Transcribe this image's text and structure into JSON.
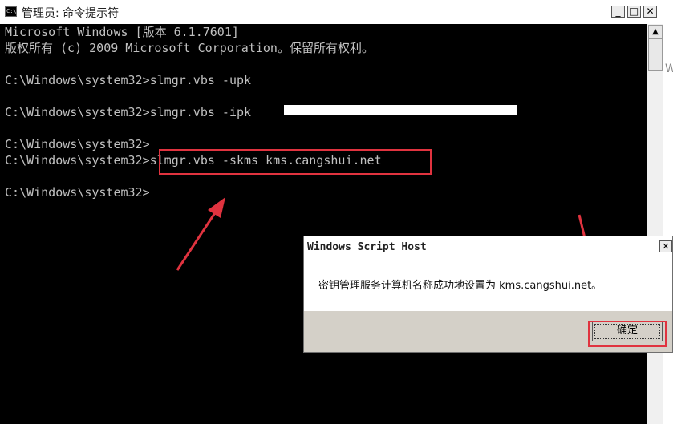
{
  "window": {
    "title": "管理员: 命令提示符",
    "icon_label": "C:\\",
    "minimize_glyph": "_",
    "maximize_glyph": "□",
    "close_glyph": "✕"
  },
  "console": {
    "lines": [
      "Microsoft Windows [版本 6.1.7601]",
      "版权所有 (c) 2009 Microsoft Corporation。保留所有权利。",
      "",
      "C:\\Windows\\system32>slmgr.vbs -upk",
      "",
      "C:\\Windows\\system32>slmgr.vbs -ipk",
      "",
      "C:\\Windows\\system32>",
      "C:\\Windows\\system32>slmgr.vbs -skms kms.cangshui.net",
      "",
      "C:\\Windows\\system32>"
    ]
  },
  "scrollbar": {
    "up_glyph": "▲"
  },
  "side_fragment": "W",
  "dialog": {
    "title": "Windows Script Host",
    "close_glyph": "✕",
    "message": "密钥管理服务计算机名称成功地设置为 kms.cangshui.net。",
    "ok_label": "确定"
  },
  "colors": {
    "console_bg": "#000000",
    "console_text": "#c0c0c0",
    "annotation_red": "#e0333f",
    "dialog_footer": "#d4d0c8"
  }
}
